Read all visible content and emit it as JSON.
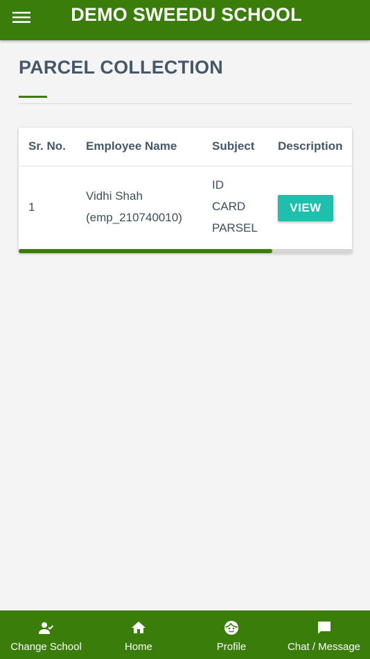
{
  "header": {
    "title": "DEMO SWEEDU SCHOOL"
  },
  "page": {
    "title": "PARCEL COLLECTION"
  },
  "table": {
    "columns": [
      "Sr. No.",
      "Employee Name",
      "Subject",
      "Description"
    ],
    "rows": [
      {
        "sr_no": "1",
        "employee_name": "Vidhi Shah",
        "employee_code": "(emp_210740010)",
        "subject_lines": [
          "ID",
          "CARD",
          "PARSEL"
        ],
        "action_label": "VIEW"
      }
    ],
    "scroll_position_fraction": 0.76
  },
  "bottom_nav": {
    "items": [
      {
        "label": "Change School",
        "icon": "person-check-icon"
      },
      {
        "label": "Home",
        "icon": "home-icon"
      },
      {
        "label": "Profile",
        "icon": "face-icon"
      },
      {
        "label": "Chat / Message",
        "icon": "chat-icon"
      }
    ]
  },
  "colors": {
    "primary": "#3a7d0a",
    "accent": "#1fbfae",
    "background": "#f4f4f4",
    "text": "#44586a"
  }
}
